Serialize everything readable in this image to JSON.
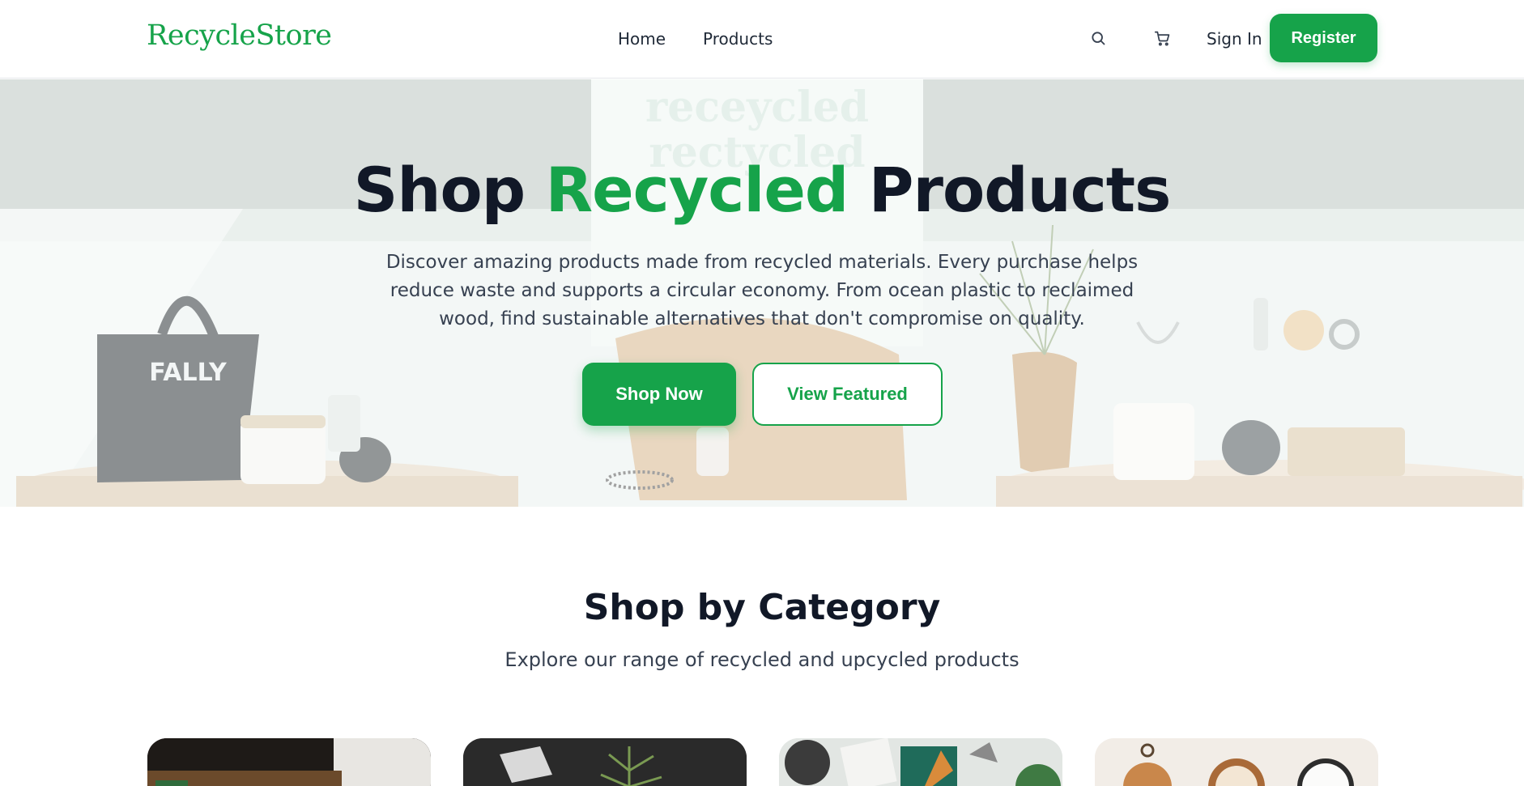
{
  "header": {
    "logo": "RecycleStore",
    "nav": {
      "home": "Home",
      "products": "Products"
    },
    "sign_in": "Sign In",
    "register": "Register",
    "icons": {
      "search": "search-icon",
      "cart": "cart-icon"
    }
  },
  "hero": {
    "title_start": "Shop",
    "title_accent": "Recycled",
    "title_end": "Products",
    "description": "Discover amazing products made from recycled materials. Every purchase helps reduce waste and supports a circular economy. From ocean plastic to reclaimed wood, find sustainable alternatives that don't compromise on quality.",
    "primary_button": "Shop Now",
    "secondary_button": "View Featured",
    "image_text": {
      "bag_label": "FALLY",
      "poster_line_1": "receycled",
      "poster_line_2": "rectycled"
    }
  },
  "category": {
    "title": "Shop by Category",
    "subtitle": "Explore our range of recycled and upcycled products",
    "cards": [
      {
        "name": "category-card-1"
      },
      {
        "name": "category-card-2"
      },
      {
        "name": "category-card-3"
      },
      {
        "name": "category-card-4"
      }
    ]
  },
  "colors": {
    "brand_green": "#16a34a",
    "text_dark": "#111827",
    "text_muted": "#374151"
  }
}
